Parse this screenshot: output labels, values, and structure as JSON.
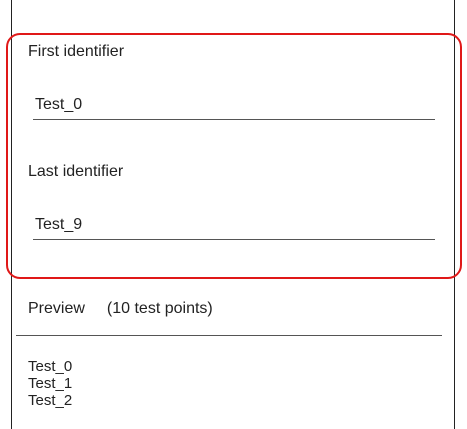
{
  "form": {
    "first": {
      "label": "First identifier",
      "value": "Test_0"
    },
    "last": {
      "label": "Last identifier",
      "value": "Test_9"
    }
  },
  "preview": {
    "label": "Preview",
    "count": "(10 test points)",
    "items": [
      "Test_0",
      "Test_1",
      "Test_2"
    ]
  },
  "colors": {
    "highlight": "#e01818"
  }
}
